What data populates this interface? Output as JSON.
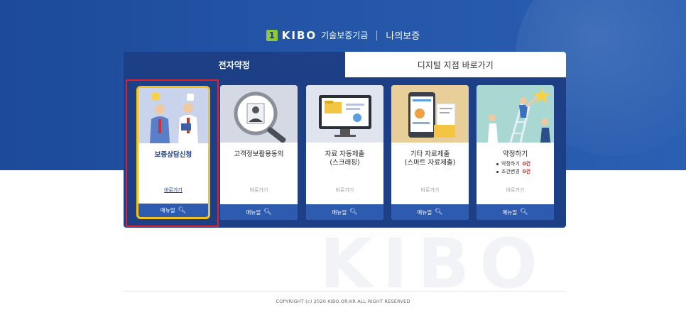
{
  "brand": {
    "logo_mark": "1",
    "logo_text": "KIBO",
    "logo_sub": "기술보증기금",
    "service": "나의보증"
  },
  "tabs": [
    {
      "label": "전자약정",
      "active": true
    },
    {
      "label": "디지털 지점 바로가기",
      "active": false
    }
  ],
  "cards": [
    {
      "title": "보증상담신청",
      "link": "바로가기",
      "manual": "매뉴얼",
      "icon": "consulting-illustration"
    },
    {
      "title": "고객정보활용동의",
      "link": "바로가기",
      "manual": "매뉴얼",
      "icon": "magnifier-profile-illustration"
    },
    {
      "title": "자료 자동제출\n(스크래핑)",
      "link": "바로가기",
      "manual": "매뉴얼",
      "icon": "monitor-folder-illustration"
    },
    {
      "title": "기타 자료제출\n(스마트 자료제출)",
      "link": "바로가기",
      "manual": "매뉴얼",
      "icon": "tablet-documents-illustration"
    },
    {
      "title": "약정하기",
      "link": "바로가기",
      "manual": "매뉴얼",
      "icon": "ladder-star-illustration",
      "stats": [
        {
          "label": "약정하기",
          "value": "0건"
        },
        {
          "label": "조건변경",
          "value": "0건"
        }
      ]
    }
  ],
  "watermark": "KIBO",
  "footer": {
    "copyright": "COPYRIGHT (c) 2020 KIBO.OR.KR ALL RIGHT RESERVED"
  },
  "colors": {
    "primary": "#1c3f86",
    "button": "#2d5bb0",
    "highlight": "#f6c21c",
    "frame": "#e0202a",
    "logo_green": "#8dc63f"
  }
}
